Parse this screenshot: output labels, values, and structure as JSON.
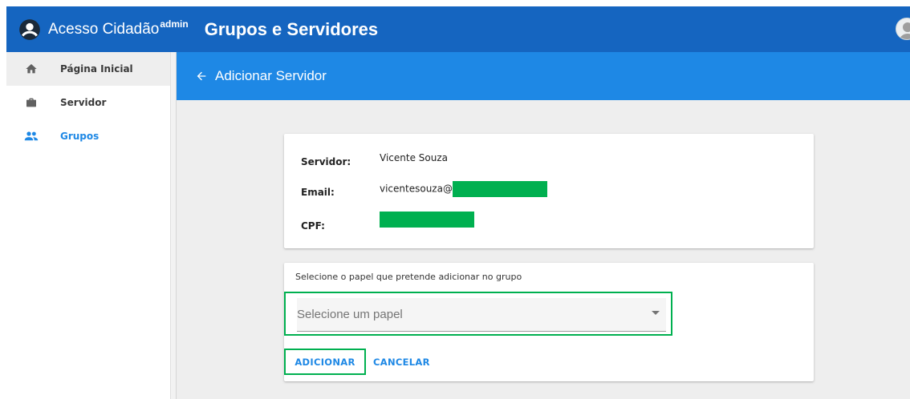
{
  "app": {
    "brand": "Acesso Cidadão",
    "brand_sup": "admin",
    "page_title": "Grupos e Servidores",
    "accent": "#1565c0"
  },
  "sidebar": {
    "items": [
      {
        "label": "Página Inicial",
        "icon": "home-icon"
      },
      {
        "label": "Servidor",
        "icon": "briefcase-icon"
      },
      {
        "label": "Grupos",
        "icon": "people-icon",
        "selected": true
      }
    ]
  },
  "header": {
    "title": "Adicionar Servidor",
    "color": "#1e88e5"
  },
  "server_info": {
    "servidor_label": "Servidor:",
    "servidor_value": "Vicente Souza",
    "email_label": "Email:",
    "email_value": "vicentesouza@",
    "cpf_label": "CPF:",
    "redaction_color": "#00b050"
  },
  "role": {
    "prompt": "Selecione o papel que pretende adicionar no grupo",
    "placeholder": "Selecione um papel"
  },
  "actions": {
    "add_label": "ADICIONAR",
    "cancel_label": "CANCELAR"
  }
}
